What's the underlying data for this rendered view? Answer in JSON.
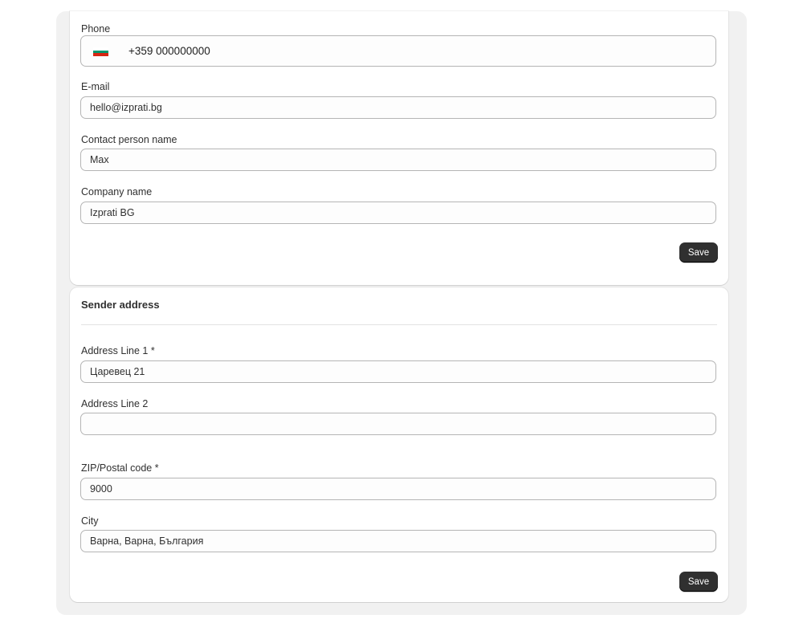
{
  "contact": {
    "phone": {
      "label": "Phone",
      "flag_icon": "bulgaria-flag-icon",
      "flag_colors": [
        "#ffffff",
        "#00966e",
        "#d62612"
      ],
      "value": "+359 000000000"
    },
    "email": {
      "label": "E-mail",
      "value": "hello@izprati.bg"
    },
    "contact_person": {
      "label": "Contact person name",
      "value": "Max"
    },
    "company": {
      "label": "Company name",
      "value": "Izprati BG"
    },
    "save_label": "Save"
  },
  "sender_address": {
    "title": "Sender address",
    "address_line1": {
      "label": "Address Line 1 *",
      "value": "Царевец 21"
    },
    "address_line2": {
      "label": "Address Line 2",
      "value": ""
    },
    "postal_code": {
      "label": "ZIP/Postal code *",
      "value": "9000"
    },
    "city": {
      "label": "City",
      "value": "Варна, Варна, България"
    },
    "save_label": "Save"
  },
  "colors": {
    "page_background": "#f1f1f1",
    "card_background": "#ffffff",
    "button_background": "#303030",
    "input_border": "#b5b5b5"
  }
}
